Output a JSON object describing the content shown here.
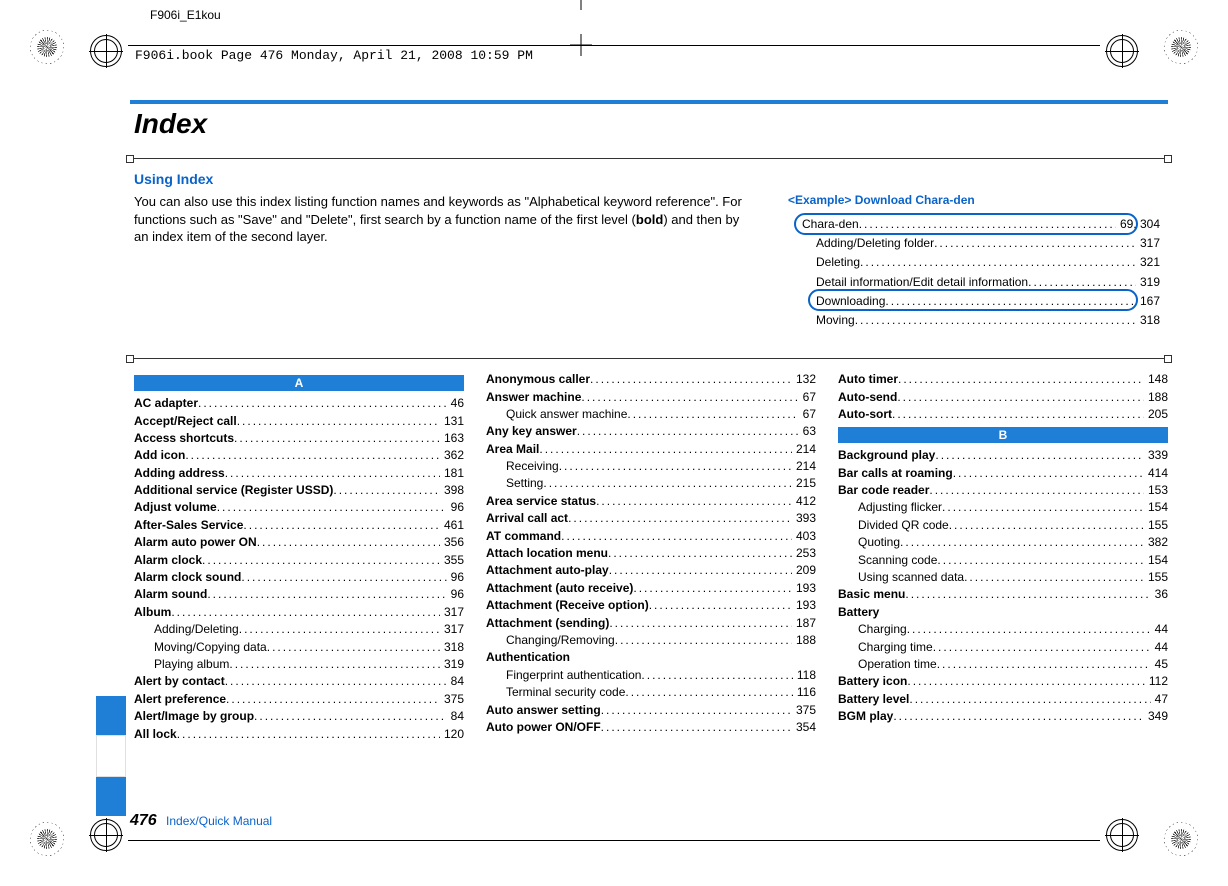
{
  "doc": {
    "file_label": "F906i_E1kou",
    "pdf_header": "F906i.book  Page 476  Monday, April 21, 2008  10:59 PM"
  },
  "page_number": "476",
  "section_footer": "Index/Quick Manual",
  "title": "Index",
  "using_index_heading": "Using Index",
  "intro_text": "You can also use this index listing function names and keywords as \"Alphabetical keyword reference\". For functions such as \"Save\" and \"Delete\", first search by a function name of the first level (",
  "intro_bold": "bold",
  "intro_text_after": ") and then by an index item of the second layer.",
  "example": {
    "title": "<Example> Download Chara-den",
    "rows": [
      {
        "label": "Chara-den",
        "page": "69, 304",
        "indent": false
      },
      {
        "label": "Adding/Deleting folder",
        "page": "317",
        "indent": true
      },
      {
        "label": "Deleting",
        "page": "321",
        "indent": true
      },
      {
        "label": "Detail information/Edit detail information",
        "page": "319",
        "indent": true
      },
      {
        "label": "Downloading",
        "page": "167",
        "indent": true
      },
      {
        "label": "Moving",
        "page": "318",
        "indent": true
      }
    ]
  },
  "columns": [
    {
      "letter": "A",
      "entries": [
        {
          "label": "AC adapter",
          "page": "46",
          "bold": true
        },
        {
          "label": "Accept/Reject call",
          "page": "131",
          "bold": true
        },
        {
          "label": "Access shortcuts",
          "page": "163",
          "bold": true
        },
        {
          "label": "Add icon",
          "page": "362",
          "bold": true
        },
        {
          "label": "Adding address",
          "page": "181",
          "bold": true
        },
        {
          "label": "Additional service (Register USSD)",
          "page": "398",
          "bold": true
        },
        {
          "label": "Adjust volume",
          "page": "96",
          "bold": true
        },
        {
          "label": "After-Sales Service",
          "page": "461",
          "bold": true
        },
        {
          "label": "Alarm auto power ON",
          "page": "356",
          "bold": true
        },
        {
          "label": "Alarm clock",
          "page": "355",
          "bold": true
        },
        {
          "label": "Alarm clock sound",
          "page": "96",
          "bold": true
        },
        {
          "label": "Alarm sound",
          "page": "96",
          "bold": true
        },
        {
          "label": "Album",
          "page": "317",
          "bold": true
        },
        {
          "label": "Adding/Deleting",
          "page": "317",
          "bold": false,
          "sub": true
        },
        {
          "label": "Moving/Copying data",
          "page": "318",
          "bold": false,
          "sub": true
        },
        {
          "label": "Playing album",
          "page": "319",
          "bold": false,
          "sub": true
        },
        {
          "label": "Alert by contact",
          "page": "84",
          "bold": true
        },
        {
          "label": "Alert preference",
          "page": "375",
          "bold": true
        },
        {
          "label": "Alert/Image by group",
          "page": "84",
          "bold": true
        },
        {
          "label": "All lock",
          "page": "120",
          "bold": true
        }
      ]
    },
    {
      "letter": null,
      "entries": [
        {
          "label": "Anonymous caller",
          "page": "132",
          "bold": true
        },
        {
          "label": "Answer machine",
          "page": "67",
          "bold": true
        },
        {
          "label": "Quick answer machine",
          "page": "67",
          "bold": false,
          "sub": true
        },
        {
          "label": "Any key answer",
          "page": "63",
          "bold": true
        },
        {
          "label": "Area Mail",
          "page": "214",
          "bold": true
        },
        {
          "label": "Receiving",
          "page": "214",
          "bold": false,
          "sub": true
        },
        {
          "label": "Setting",
          "page": "215",
          "bold": false,
          "sub": true
        },
        {
          "label": "Area service status",
          "page": "412",
          "bold": true
        },
        {
          "label": "Arrival call act",
          "page": "393",
          "bold": true
        },
        {
          "label": "AT command",
          "page": "403",
          "bold": true
        },
        {
          "label": "Attach location menu",
          "page": "253",
          "bold": true
        },
        {
          "label": "Attachment auto-play",
          "page": "209",
          "bold": true
        },
        {
          "label": "Attachment (auto receive)",
          "page": "193",
          "bold": true
        },
        {
          "label": "Attachment (Receive option)",
          "page": "193",
          "bold": true
        },
        {
          "label": "Attachment (sending)",
          "page": "187",
          "bold": true
        },
        {
          "label": "Changing/Removing",
          "page": "188",
          "bold": false,
          "sub": true
        },
        {
          "label": "Authentication",
          "page": "",
          "bold": true,
          "nopage": true
        },
        {
          "label": "Fingerprint authentication",
          "page": "118",
          "bold": false,
          "sub": true
        },
        {
          "label": "Terminal security code",
          "page": "116",
          "bold": false,
          "sub": true
        },
        {
          "label": "Auto answer setting",
          "page": "375",
          "bold": true
        },
        {
          "label": "Auto power ON/OFF",
          "page": "354",
          "bold": true
        }
      ]
    },
    {
      "letter": "B",
      "pre_entries": [
        {
          "label": "Auto timer",
          "page": "148",
          "bold": true
        },
        {
          "label": "Auto-send",
          "page": "188",
          "bold": true
        },
        {
          "label": "Auto-sort",
          "page": "205",
          "bold": true
        }
      ],
      "entries": [
        {
          "label": "Background play",
          "page": "339",
          "bold": true
        },
        {
          "label": "Bar calls at roaming",
          "page": "414",
          "bold": true
        },
        {
          "label": "Bar code reader",
          "page": "153",
          "bold": true
        },
        {
          "label": "Adjusting flicker",
          "page": "154",
          "bold": false,
          "sub": true
        },
        {
          "label": "Divided QR code",
          "page": "155",
          "bold": false,
          "sub": true
        },
        {
          "label": "Quoting",
          "page": "382",
          "bold": false,
          "sub": true
        },
        {
          "label": "Scanning code",
          "page": "154",
          "bold": false,
          "sub": true
        },
        {
          "label": "Using scanned data",
          "page": "155",
          "bold": false,
          "sub": true
        },
        {
          "label": "Basic menu",
          "page": "36",
          "bold": true
        },
        {
          "label": "Battery",
          "page": "",
          "bold": true,
          "nopage": true
        },
        {
          "label": "Charging",
          "page": "44",
          "bold": false,
          "sub": true
        },
        {
          "label": "Charging time",
          "page": "44",
          "bold": false,
          "sub": true
        },
        {
          "label": "Operation time",
          "page": "45",
          "bold": false,
          "sub": true
        },
        {
          "label": "Battery icon",
          "page": "112",
          "bold": true
        },
        {
          "label": "Battery level",
          "page": "47",
          "bold": true
        },
        {
          "label": "BGM play",
          "page": "349",
          "bold": true
        }
      ]
    }
  ]
}
